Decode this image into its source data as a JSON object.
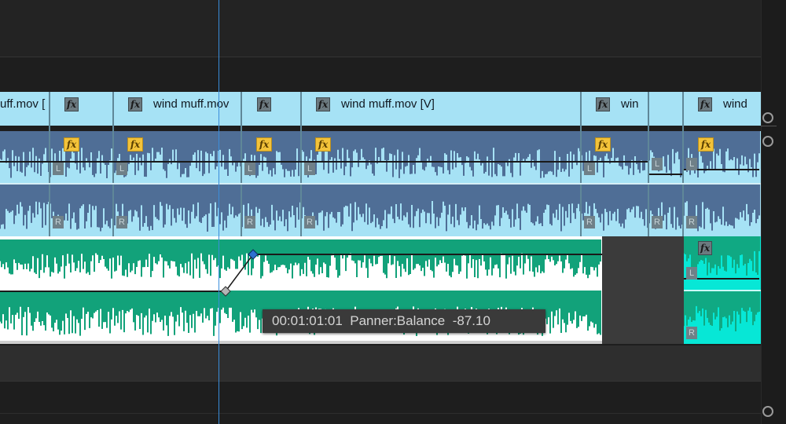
{
  "video_track": {
    "clips": [
      {
        "title": "uff.mov ["
      },
      {
        "title": ""
      },
      {
        "title": "wind muff.mov"
      },
      {
        "title": ""
      },
      {
        "title": "wind muff.mov [V]"
      },
      {
        "title": "win"
      },
      {
        "title": ""
      },
      {
        "title": "wind"
      }
    ]
  },
  "audio_track": {
    "fx_label": "fx",
    "channel_left": "L",
    "channel_right": "R"
  },
  "tooltip": {
    "timecode": "00:01:01:01",
    "parameter": "Panner:Balance",
    "value": "-87.10"
  },
  "colors": {
    "video_clip": "#a6e2f5",
    "audio_wave_blue": "#4f6e96",
    "audio_wave_green": "#12a27a",
    "selected_clip": "#07e7d6",
    "playhead": "#3a8ddb",
    "keyframe": "#2f6fd0"
  },
  "icons": {
    "effect_badge": "fx-icon",
    "keyframe": "keyframe-diamond-icon",
    "scroll_handle": "scroll-handle-icon"
  }
}
